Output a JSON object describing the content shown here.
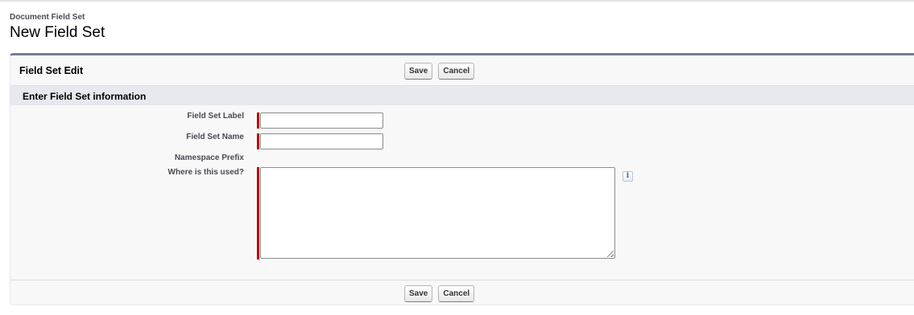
{
  "header": {
    "object_type": "Document Field Set",
    "title": "New Field Set"
  },
  "block": {
    "title": "Field Set Edit",
    "save_label": "Save",
    "cancel_label": "Cancel"
  },
  "section": {
    "title": "Enter Field Set information"
  },
  "fields": {
    "label": {
      "label": "Field Set Label",
      "value": ""
    },
    "name": {
      "label": "Field Set Name",
      "value": ""
    },
    "namespace": {
      "label": "Namespace Prefix",
      "value": ""
    },
    "usage": {
      "label": "Where is this used?",
      "value": ""
    }
  },
  "icons": {
    "info": "i"
  },
  "colors": {
    "required": "#c00000",
    "block_border": "#747e96",
    "section_bg": "#e6e9ed"
  }
}
